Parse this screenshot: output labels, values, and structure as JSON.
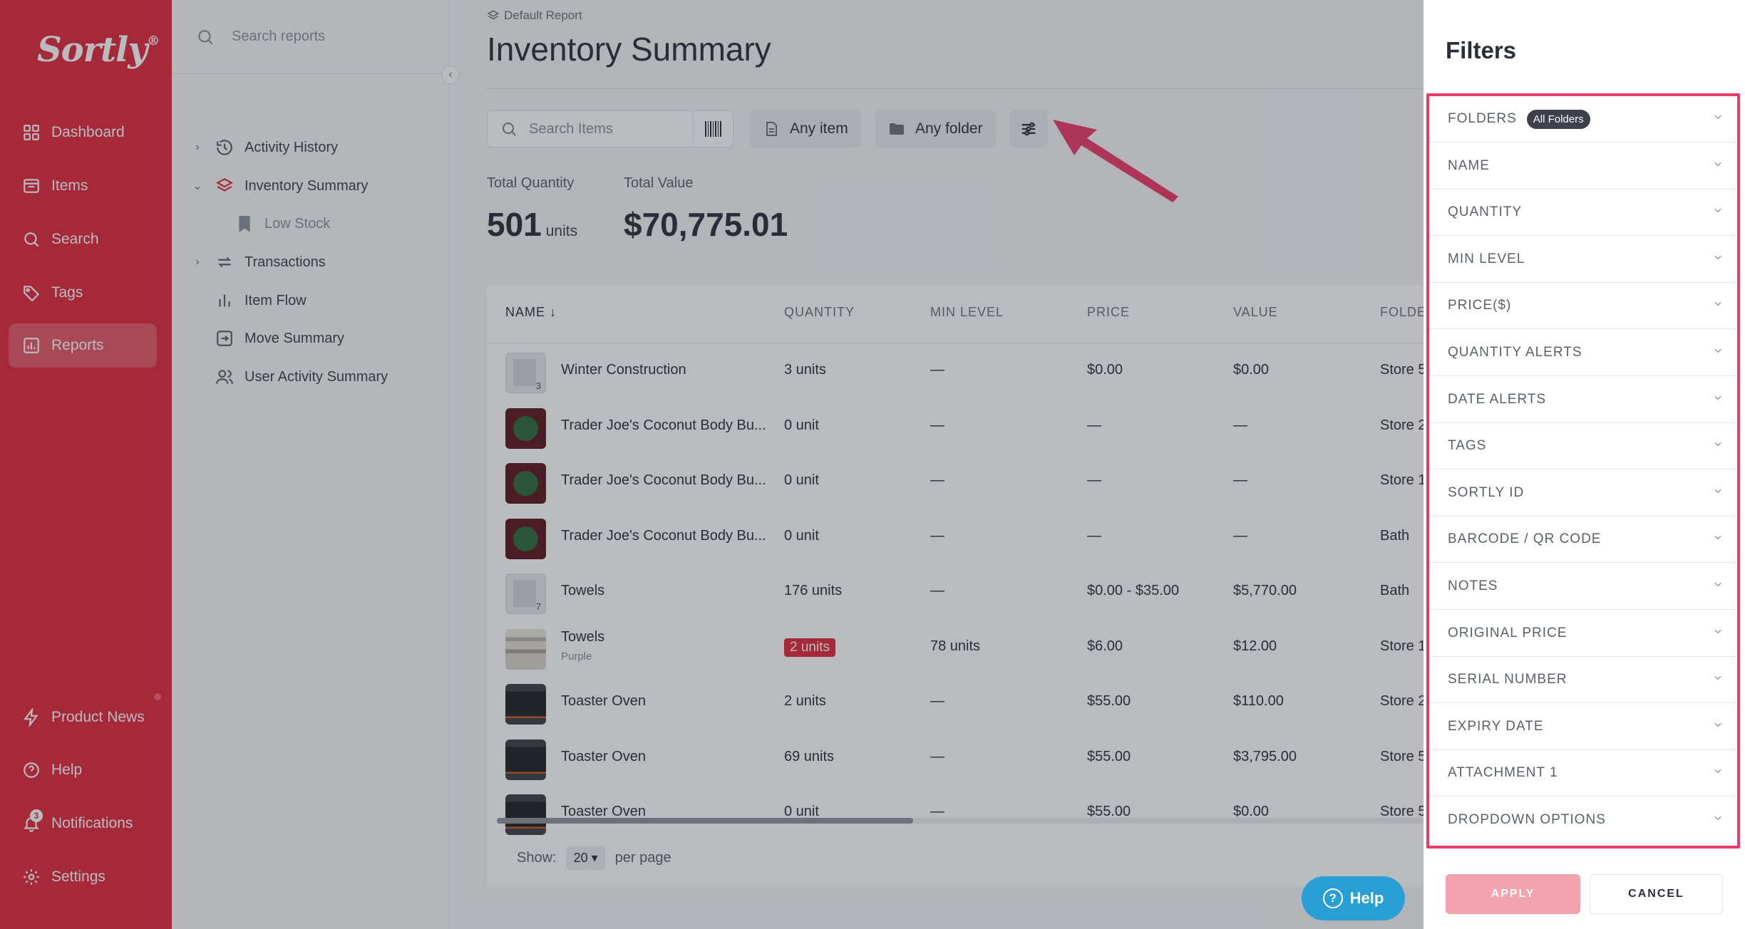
{
  "nav": {
    "logo": "Sortly",
    "logo_mark": "®",
    "items": [
      {
        "label": "Dashboard",
        "icon": "dashboard-icon"
      },
      {
        "label": "Items",
        "icon": "items-icon"
      },
      {
        "label": "Search",
        "icon": "search-icon"
      },
      {
        "label": "Tags",
        "icon": "tag-icon"
      },
      {
        "label": "Reports",
        "icon": "reports-icon",
        "active": true
      }
    ],
    "bottom": [
      {
        "label": "Product News",
        "icon": "lightning-icon"
      },
      {
        "label": "Help",
        "icon": "help-icon"
      },
      {
        "label": "Notifications",
        "icon": "bell-icon",
        "badge": "3"
      },
      {
        "label": "Settings",
        "icon": "gear-icon"
      }
    ]
  },
  "reports_sidebar": {
    "search_placeholder": "Search reports",
    "tree": [
      {
        "label": "Activity History",
        "icon": "history-icon",
        "chevron": "›"
      },
      {
        "label": "Inventory Summary",
        "icon": "layers-icon",
        "chevron": "⌄",
        "active": true
      },
      {
        "label": "Low Stock",
        "icon": "bookmark-icon",
        "sub": true
      },
      {
        "label": "Transactions",
        "icon": "transfer-icon",
        "chevron": "›"
      },
      {
        "label": "Item Flow",
        "icon": "bar-chart-icon"
      },
      {
        "label": "Move Summary",
        "icon": "move-icon"
      },
      {
        "label": "User Activity Summary",
        "icon": "users-icon"
      }
    ]
  },
  "main": {
    "breadcrumb": "Default Report",
    "title": "Inventory Summary",
    "search_placeholder": "Search Items",
    "filter_any_item": "Any item",
    "filter_any_folder": "Any folder",
    "total_quantity_label": "Total Quantity",
    "total_quantity": "501",
    "total_quantity_unit": "units",
    "total_value_label": "Total Value",
    "total_value": "$70,775.01",
    "columns": [
      "NAME",
      "QUANTITY",
      "MIN LEVEL",
      "PRICE",
      "VALUE",
      "FOLDER"
    ],
    "rows": [
      {
        "thumb": "file",
        "count": "3",
        "name": "Winter Construction",
        "sub": "",
        "qty": "3 units",
        "alert": false,
        "min": "—",
        "price": "$0.00",
        "value": "$0.00",
        "folder": "Store 5"
      },
      {
        "thumb": "jar",
        "name": "Trader Joe's Coconut Body Bu...",
        "sub": "",
        "qty": "0 unit",
        "alert": false,
        "min": "—",
        "price": "—",
        "value": "—",
        "folder": "Store 2"
      },
      {
        "thumb": "jar",
        "name": "Trader Joe's Coconut Body Bu...",
        "sub": "",
        "qty": "0 unit",
        "alert": false,
        "min": "—",
        "price": "—",
        "value": "—",
        "folder": "Store 1"
      },
      {
        "thumb": "jar",
        "name": "Trader Joe's Coconut Body Bu...",
        "sub": "",
        "qty": "0 unit",
        "alert": false,
        "min": "—",
        "price": "—",
        "value": "—",
        "folder": "Bath"
      },
      {
        "thumb": "file",
        "count": "7",
        "name": "Towels",
        "sub": "",
        "qty": "176 units",
        "alert": false,
        "min": "—",
        "price": "$0.00 - $35.00",
        "value": "$5,770.00",
        "folder": "Bath"
      },
      {
        "thumb": "towel",
        "name": "Towels",
        "sub": "Purple",
        "qty": "2 units",
        "alert": true,
        "min": "78 units",
        "price": "$6.00",
        "value": "$12.00",
        "folder": "Store 1"
      },
      {
        "thumb": "oven",
        "name": "Toaster Oven",
        "sub": "",
        "qty": "2 units",
        "alert": false,
        "min": "—",
        "price": "$55.00",
        "value": "$110.00",
        "folder": "Store 2"
      },
      {
        "thumb": "oven",
        "name": "Toaster Oven",
        "sub": "",
        "qty": "69 units",
        "alert": false,
        "min": "—",
        "price": "$55.00",
        "value": "$3,795.00",
        "folder": "Store 5"
      },
      {
        "thumb": "oven",
        "name": "Toaster Oven",
        "sub": "",
        "qty": "0 unit",
        "alert": false,
        "min": "—",
        "price": "$55.00",
        "value": "$0.00",
        "folder": "Store 5"
      }
    ],
    "pager_show": "Show:",
    "pager_value": "20 ▾",
    "pager_per": "per page",
    "help_button": "Help"
  },
  "filters": {
    "title": "Filters",
    "rows": [
      {
        "label": "FOLDERS",
        "pill": "All Folders"
      },
      {
        "label": "NAME"
      },
      {
        "label": "QUANTITY"
      },
      {
        "label": "MIN LEVEL"
      },
      {
        "label": "PRICE($)"
      },
      {
        "label": "QUANTITY ALERTS"
      },
      {
        "label": "DATE ALERTS"
      },
      {
        "label": "TAGS"
      },
      {
        "label": "SORTLY ID"
      },
      {
        "label": "BARCODE / QR CODE"
      },
      {
        "label": "NOTES"
      },
      {
        "label": "ORIGINAL PRICE"
      },
      {
        "label": "SERIAL NUMBER"
      },
      {
        "label": "EXPIRY DATE"
      },
      {
        "label": "ATTACHMENT 1"
      },
      {
        "label": "DROPDOWN OPTIONS"
      }
    ],
    "apply": "APPLY",
    "cancel": "CANCEL"
  },
  "colors": {
    "brand": "#e1283c",
    "highlight": "#ea3a6a",
    "help": "#2a9fd6"
  }
}
